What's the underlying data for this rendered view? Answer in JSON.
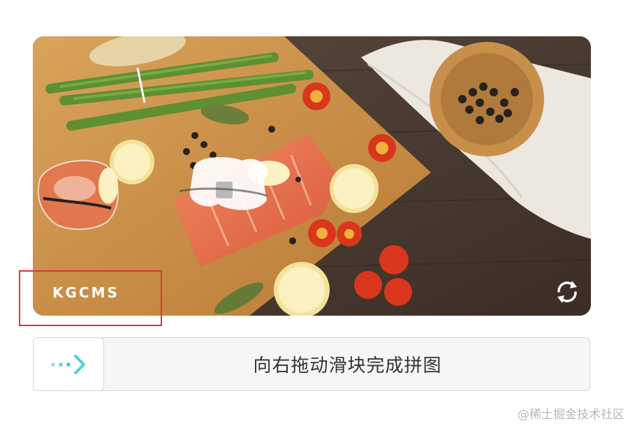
{
  "captcha": {
    "brand_logo": "KGCMS",
    "slider_hint": "向右拖动滑块完成拼图",
    "refresh_icon": "refresh-icon",
    "handle_icon": "double-arrow-right-icon"
  },
  "watermark": "@稀土掘金技术社区",
  "colors": {
    "highlight": "#d9343a",
    "arrow_accent": "#4fd1d9",
    "track_bg": "#f5f6f7",
    "label_text": "#333333"
  }
}
